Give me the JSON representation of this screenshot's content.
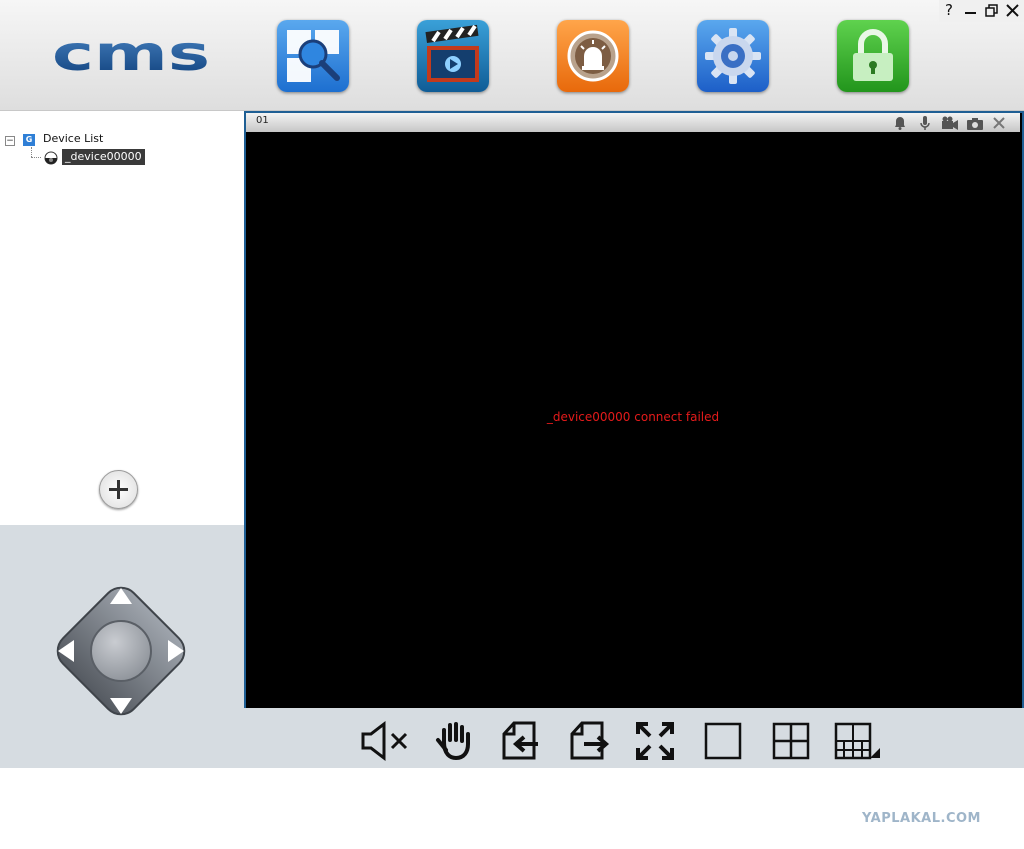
{
  "header": {
    "logo_text": "cms",
    "tools": [
      {
        "name": "search-tool",
        "icon": "magnifier-icon"
      },
      {
        "name": "playback-tool",
        "icon": "clapperboard-icon"
      },
      {
        "name": "alarm-tool",
        "icon": "alarm-light-icon"
      },
      {
        "name": "settings-tool",
        "icon": "gear-icon"
      },
      {
        "name": "lock-tool",
        "icon": "padlock-icon"
      }
    ],
    "colors": {
      "search": "#2f86e0",
      "playback": "#1a6fa8",
      "alarm": "#f47a14",
      "settings": "#2a6fd8",
      "lock": "#35b02a"
    }
  },
  "window_controls": {
    "help": "?",
    "minimize": "minimize-icon",
    "restore": "restore-icon",
    "close": "close-icon"
  },
  "device_tree": {
    "root_label": "Device List",
    "root_toggle": "−",
    "root_icon_letter": "G",
    "devices": [
      {
        "label": "_device00000",
        "icon": "camera-dome-icon",
        "selected": true
      }
    ]
  },
  "video": {
    "channel": "01",
    "status": "_device00000 connect failed",
    "status_color": "#e41b1b",
    "title_icons": [
      "bell-icon",
      "microphone-icon",
      "video-camera-icon",
      "snapshot-camera-icon",
      "close-icon"
    ]
  },
  "toolbar": {
    "buttons": [
      "mute-icon",
      "stop-hand-icon",
      "previous-page-icon",
      "next-page-icon",
      "fullscreen-icon",
      "single-view-icon",
      "quad-view-icon",
      "multi-view-icon"
    ]
  },
  "watermark": "YAPLAKAL.COM"
}
